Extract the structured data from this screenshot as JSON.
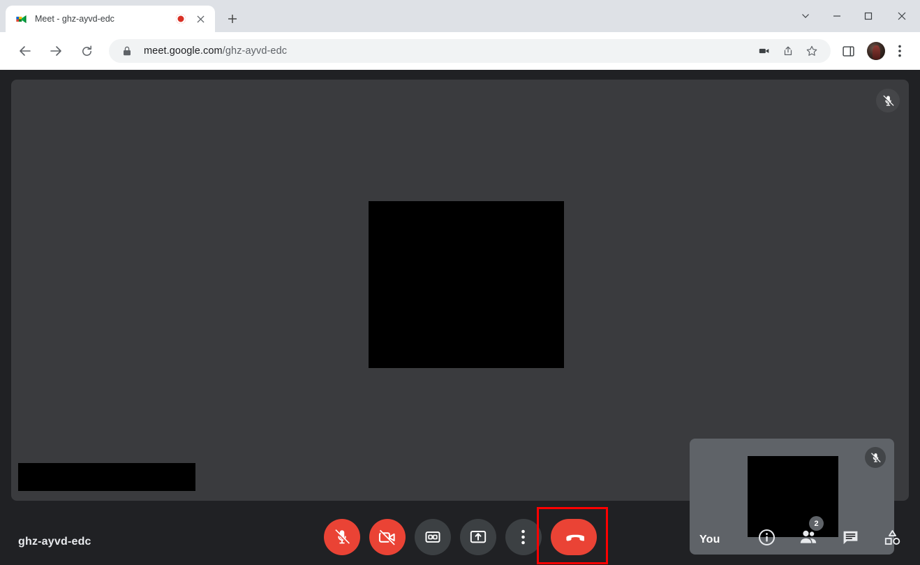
{
  "browser": {
    "tab": {
      "title": "Meet - ghz-ayvd-edc",
      "favicon_icon": "google-meet-favicon",
      "recording_icon": "recording-indicator-icon",
      "close_icon": "close-icon"
    },
    "new_tab_icon": "plus-icon",
    "window_controls": {
      "tab_search_icon": "chevron-down-icon",
      "minimize_icon": "minimize-icon",
      "maximize_icon": "maximize-icon",
      "close_icon": "window-close-icon"
    },
    "nav": {
      "back_icon": "arrow-left-icon",
      "forward_icon": "arrow-right-icon",
      "reload_icon": "reload-icon"
    },
    "omnibox": {
      "lock_icon": "lock-icon",
      "url_domain": "meet.google.com",
      "url_path": "/ghz-ayvd-edc",
      "camera_icon": "video-camera-permission-icon",
      "share_icon": "share-icon",
      "bookmark_icon": "star-icon"
    },
    "side_panel_icon": "side-panel-icon",
    "profile_icon": "profile-avatar",
    "menu_icon": "three-dot-menu-icon"
  },
  "meet": {
    "meeting_code": "ghz-ayvd-edc",
    "main_tile": {
      "mic_muted_icon": "mic-off-icon",
      "name_redacted": true
    },
    "self_tile": {
      "label": "You",
      "mic_muted_icon": "mic-off-icon"
    },
    "controls": [
      {
        "name": "microphone-toggle",
        "icon": "mic-off-icon",
        "state": "muted",
        "color": "#ea4335"
      },
      {
        "name": "camera-toggle",
        "icon": "video-off-icon",
        "state": "off",
        "color": "#ea4335"
      },
      {
        "name": "captions-toggle",
        "icon": "closed-captions-icon",
        "state": "off",
        "color": "#3c4043"
      },
      {
        "name": "present-screen",
        "icon": "present-screen-icon",
        "state": "off",
        "color": "#3c4043"
      },
      {
        "name": "more-options",
        "icon": "three-dot-vertical-icon",
        "state": "off",
        "color": "#3c4043"
      },
      {
        "name": "leave-call",
        "icon": "end-call-icon",
        "state": "active",
        "color": "#ea4335"
      }
    ],
    "highlight": {
      "target": "leave-call",
      "color": "#ff0000"
    },
    "right_controls": [
      {
        "name": "meeting-details",
        "icon": "info-icon"
      },
      {
        "name": "show-everyone",
        "icon": "people-icon",
        "badge": "2"
      },
      {
        "name": "chat-with-everyone",
        "icon": "chat-bubble-icon"
      },
      {
        "name": "activities",
        "icon": "activities-shapes-icon"
      }
    ]
  }
}
